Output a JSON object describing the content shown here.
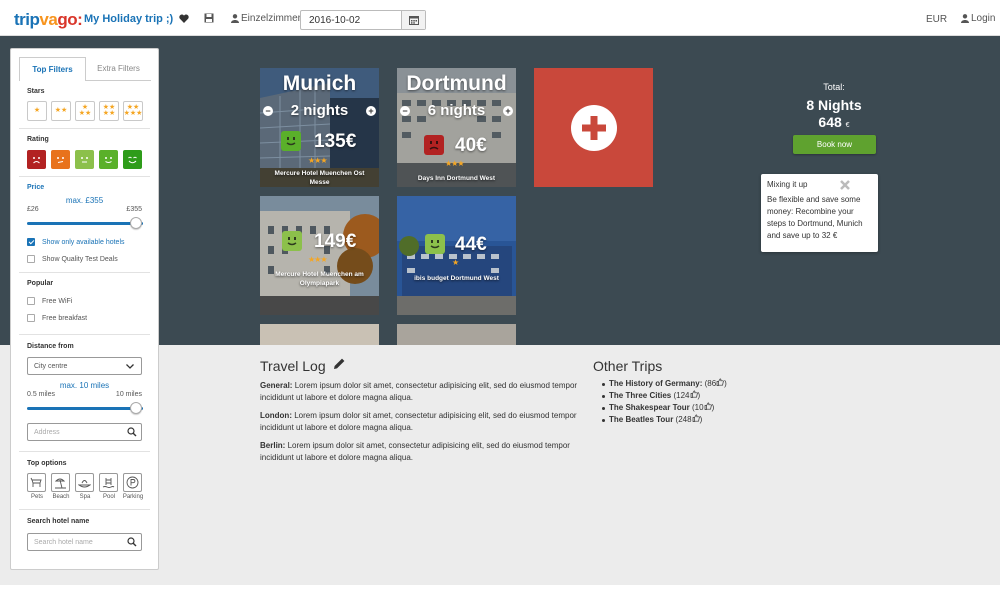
{
  "header": {
    "logo": {
      "part1": "trip",
      "part2": "va",
      "part3": "go:"
    },
    "trip_title": "My Holiday trip ;)",
    "icons": [
      "heart-icon",
      "save-icon",
      "user-icon"
    ],
    "room": "Einzelzimmer",
    "date_value": "2016-10-02",
    "currency": "EUR",
    "login": "Login"
  },
  "sidebar": {
    "tabs": [
      "Top Filters",
      "Extra Filters"
    ],
    "stars_title": "Stars",
    "rating_title": "Rating",
    "rating_colors": [
      "#b22222",
      "#e8721c",
      "#8cc04b",
      "#5ab02a",
      "#2e9c1a"
    ],
    "price": {
      "title": "Price",
      "max_label": "max. £355",
      "min": "£26",
      "max": "£355",
      "level": 1.0
    },
    "show_available": "Show only available hotels",
    "show_quality": "Show Quality Test Deals",
    "popular_title": "Popular",
    "free_wifi": "Free WiFi",
    "free_breakfast": "Free breakfast",
    "distance": {
      "title": "Distance from",
      "selected": "City centre",
      "max_label": "max. 10 miles",
      "min": "0.5 miles",
      "max": "10 miles",
      "level": 1.0,
      "address_placeholder": "Address"
    },
    "top_options_title": "Top options",
    "top_options": [
      "Pets",
      "Beach",
      "Spa",
      "Pool",
      "Parking"
    ],
    "search_title": "Search hotel name",
    "search_placeholder": "Search hotel name"
  },
  "cards": [
    {
      "city": "Munich",
      "nights": "2 nights",
      "price": "135€",
      "stars": "★★★",
      "hotel": "Mercure Hotel Muenchen Ost Messe",
      "rating_color": "#5ab02a"
    },
    {
      "city": "Dortmund",
      "nights": "6 nights",
      "price": "40€",
      "stars": "★★★",
      "hotel": "Days Inn Dortmund West",
      "rating_color": "#b22222"
    },
    {
      "price": "149€",
      "stars": "★★★",
      "hotel": "Mercure Hotel Muenchen am Olympiapark",
      "rating_color": "#8cc04b"
    },
    {
      "price": "44€",
      "stars": "★",
      "hotel": "ibis budget Dortmund West",
      "rating_color": "#8cc04b"
    }
  ],
  "total": {
    "label": "Total:",
    "nights": "8 Nights",
    "price": "648",
    "currency": "€",
    "book": "Book now"
  },
  "tip": {
    "title": "Mixing it up",
    "text": "Be flexible and save some money: Recombine your steps to Dortmund, Munich and save up to 32 €"
  },
  "travel_log": {
    "title": "Travel Log",
    "entries": [
      {
        "label": "General:",
        "text": "Lorem ipsum dolor sit amet, consectetur adipisicing elit, sed do eiusmod tempor incididunt ut labore et dolore magna aliqua."
      },
      {
        "label": "London:",
        "text": "Lorem ipsum dolor sit amet, consectetur adipisicing elit, sed do eiusmod tempor incididunt ut labore et dolore magna aliqua."
      },
      {
        "label": "Berlin:",
        "text": "Lorem ipsum dolor sit amet, consectetur adipisicing elit, sed do eiusmod tempor incididunt ut labore et dolore magna aliqua."
      }
    ]
  },
  "other_trips": {
    "title": "Other Trips",
    "items": [
      {
        "name": "The History of Germany:",
        "count": "(86"
      },
      {
        "name": "The Three Cities",
        "count": "(124"
      },
      {
        "name": "The Shakespear Tour",
        "count": "(10"
      },
      {
        "name": "The Beatles Tour",
        "count": "(248"
      }
    ]
  }
}
